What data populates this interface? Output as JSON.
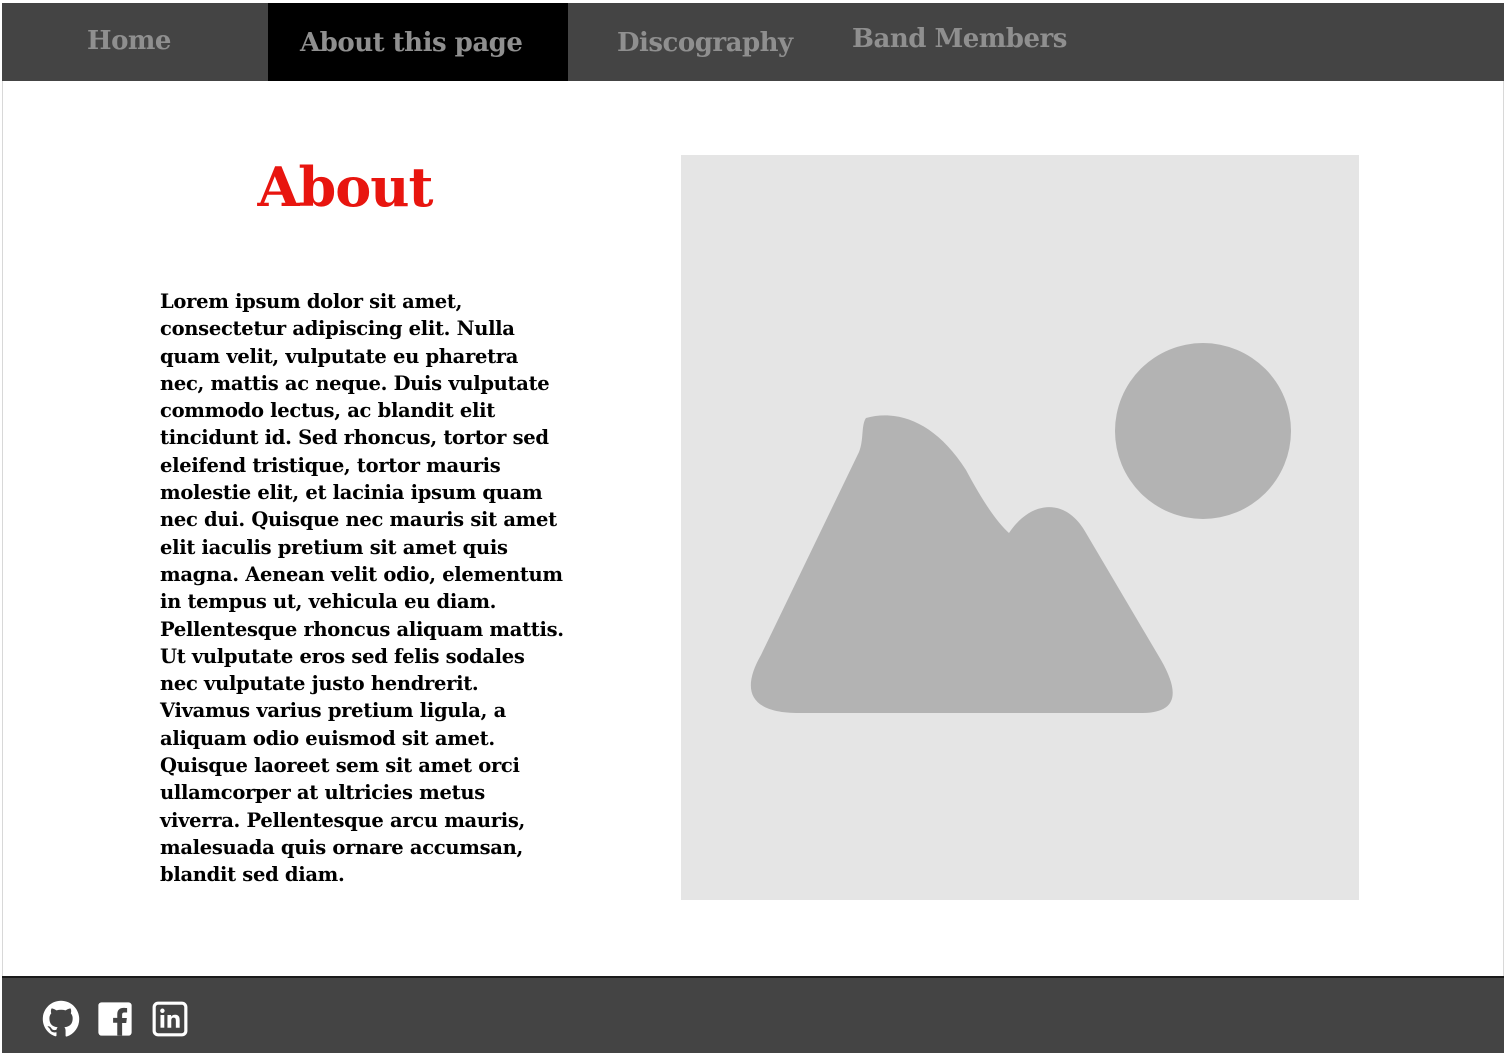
{
  "nav": {
    "items": [
      {
        "label": "Home"
      },
      {
        "label": "About this page"
      },
      {
        "label": "Discography"
      },
      {
        "label": "Band Members"
      }
    ],
    "active_index": 1
  },
  "main": {
    "title": "About",
    "body": "Lorem ipsum dolor sit amet, consectetur adipiscing elit. Nulla quam velit, vulputate eu pharetra nec, mattis ac neque. Duis vulputate commodo lectus, ac blandit elit tincidunt id. Sed rhoncus, tortor sed eleifend tristique, tortor mauris molestie elit, et lacinia ipsum quam nec dui. Quisque nec mauris sit amet elit iaculis pretium sit amet quis magna. Aenean velit odio, elementum in tempus ut, vehicula eu diam. Pellentesque rhoncus aliquam mattis. Ut vulputate eros sed felis sodales nec vulputate justo hendrerit. Vivamus varius pretium ligula, a aliquam odio euismod sit amet. Quisque laoreet sem sit amet orci ullamcorper at ultricies metus viverra. Pellentesque arcu mauris, malesuada quis ornare accumsan, blandit sed diam.",
    "image_icon": "image-placeholder-icon"
  },
  "footer": {
    "icons": [
      "github-icon",
      "facebook-icon",
      "linkedin-icon"
    ]
  },
  "colors": {
    "nav_background": "#444444",
    "nav_active_background": "#000000",
    "nav_text": "#8f8f8f",
    "title_accent": "#e8150f",
    "placeholder_background": "#e5e5e5",
    "placeholder_shape": "#b3b3b3",
    "footer_background": "#444444",
    "footer_icon": "#ffffff"
  }
}
